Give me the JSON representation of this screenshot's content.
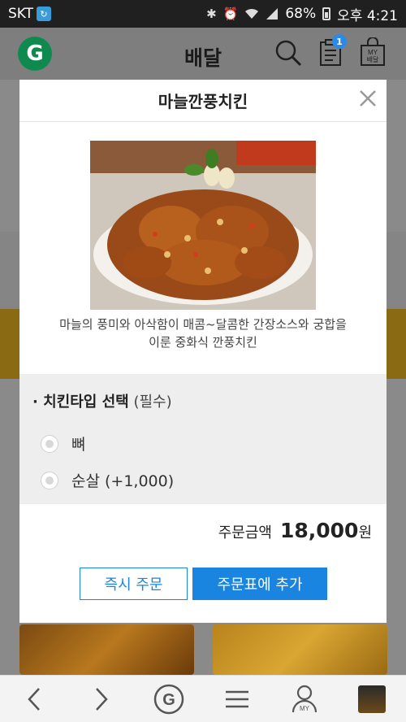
{
  "status_bar": {
    "carrier": "SKT",
    "battery": "68%",
    "time": "오후 4:21",
    "icons": [
      "bluetooth-icon",
      "alarm-icon",
      "wifi-icon",
      "signal-icon",
      "battery-icon"
    ]
  },
  "header": {
    "logo": "G",
    "title": "배달",
    "cart_badge": "1",
    "my_label_top": "MY",
    "my_label_bottom": "배달"
  },
  "modal": {
    "title": "마늘깐풍치킨",
    "description": "마늘의 풍미와 아삭함이 매콤~달콤한 간장소스와 궁합을 이룬 중화식 깐풍치킨",
    "option": {
      "title": "· 치킨타입 선택",
      "required": "(필수)",
      "choices": [
        {
          "label": "뼈"
        },
        {
          "label": "순살 (+1,000)"
        }
      ]
    },
    "total": {
      "label": "주문금액",
      "amount": "18,000",
      "unit": "원"
    },
    "buttons": {
      "order_now": "즉시 주문",
      "add_to_list": "주문표에 추가"
    }
  },
  "bottom_nav": {
    "logo": "G",
    "my_label": "MY"
  },
  "colors": {
    "accent": "#1a85e0",
    "logo_green": "#0f8a4f",
    "status_bar": "#202020",
    "overlay": "#7e7e7e"
  }
}
